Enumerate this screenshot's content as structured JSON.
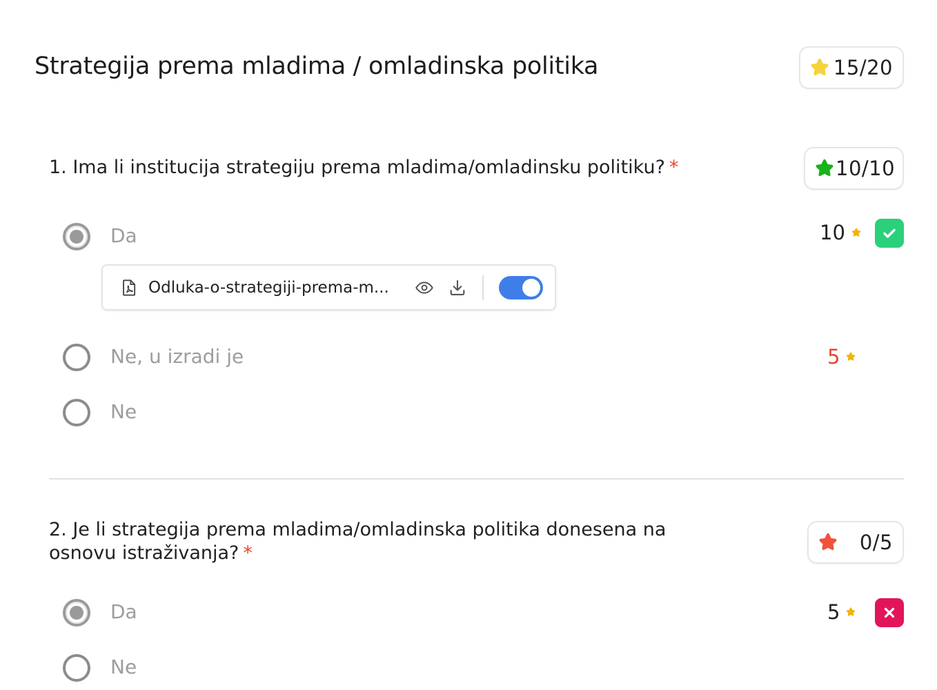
{
  "section": {
    "title": "Strategija prema mladima / omladinska politika",
    "score": "15/20",
    "score_icon": "star-yellow-icon"
  },
  "questions": [
    {
      "number_text": "1. Ima li institucija strategiju prema mladima/omladinsku politiku?",
      "required_mark": "*",
      "score": "10/10",
      "score_icon": "star-green-icon",
      "options": [
        {
          "label": "Da",
          "selected": true,
          "points": "10",
          "status": "correct"
        },
        {
          "label": "Ne, u izradi je",
          "selected": false,
          "points": "5",
          "points_color": "#e8472f"
        },
        {
          "label": "Ne",
          "selected": false
        }
      ],
      "attachment": {
        "file_name": "Odluka-o-strategiji-prema-m...",
        "toggle_on": true
      }
    },
    {
      "line1": "2. Je li strategija prema mladima/omladinska politika donesena na",
      "line2": "osnovu istraživanja?",
      "required_mark": "*",
      "score": "0/5",
      "score_icon": "star-red-icon",
      "options": [
        {
          "label": "Da",
          "selected": true,
          "points": "5",
          "status": "incorrect"
        },
        {
          "label": "Ne",
          "selected": false
        }
      ]
    }
  ],
  "colors": {
    "star_yellow": "#f5d33a",
    "star_green": "#19b21c",
    "star_red": "#f2503a",
    "points_star": "#f0b40f",
    "correct": "#2ad07a",
    "incorrect": "#e3155a",
    "toggle": "#3f7ee8",
    "required": "#e8472f"
  }
}
